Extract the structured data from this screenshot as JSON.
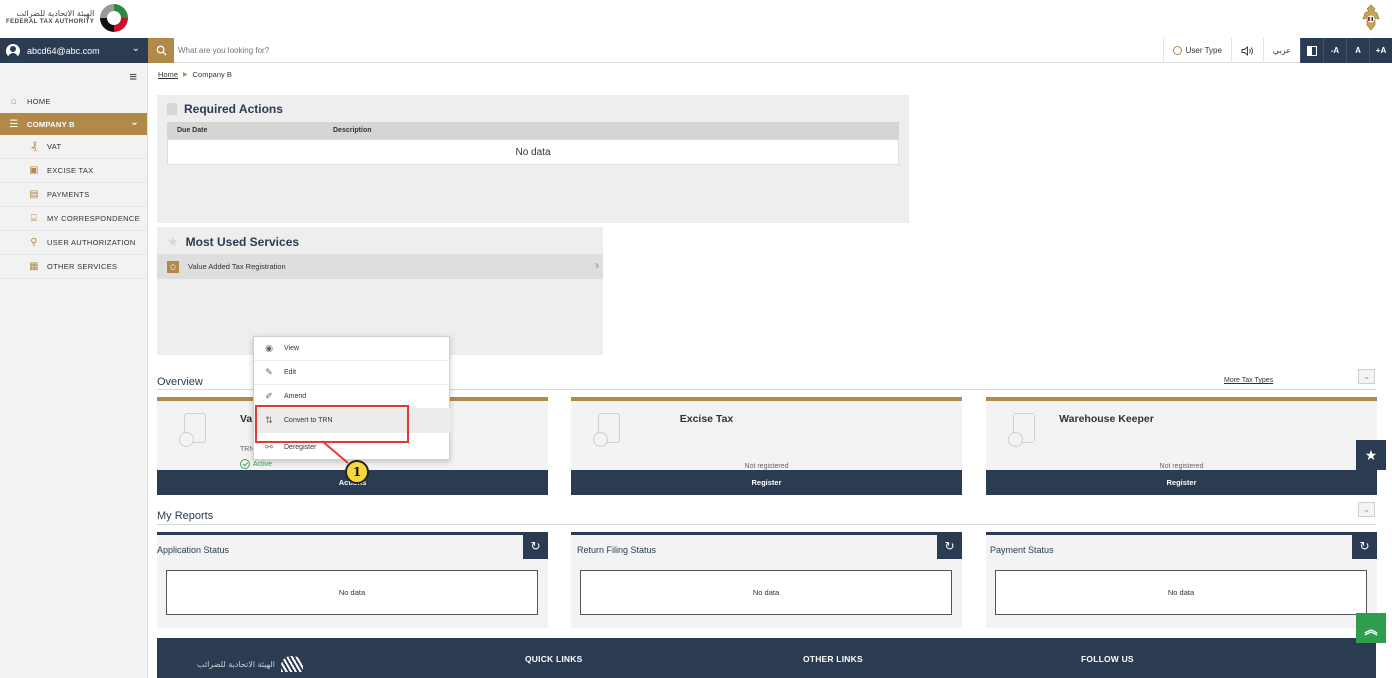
{
  "header": {
    "logo_ar": "الهيئة الاتحادية للضرائب",
    "logo_en": "FEDERAL TAX AUTHORITY"
  },
  "navbar": {
    "user_email": "abcd64@abc.com",
    "search_placeholder": "What are you looking for?",
    "user_type": "User Type",
    "language": "عربي",
    "font_decrease": "-A",
    "font_normal": "A",
    "font_increase": "+A"
  },
  "sidebar": {
    "home": "HOME",
    "company": "COMPANY B",
    "items": [
      {
        "label": "VAT",
        "icon": "vat-icon"
      },
      {
        "label": "EXCISE TAX",
        "icon": "excise-icon"
      },
      {
        "label": "PAYMENTS",
        "icon": "payments-icon"
      },
      {
        "label": "MY CORRESPONDENCE",
        "icon": "correspondence-icon"
      },
      {
        "label": "USER AUTHORIZATION",
        "icon": "user-auth-icon"
      },
      {
        "label": "OTHER SERVICES",
        "icon": "other-services-icon"
      }
    ]
  },
  "breadcrumb": {
    "home": "Home",
    "current": "Company B"
  },
  "required_actions": {
    "title": "Required Actions",
    "columns": [
      "Due Date",
      "Description"
    ],
    "empty": "No data"
  },
  "most_used": {
    "title": "Most Used Services",
    "items": [
      "Value Added Tax Registration"
    ]
  },
  "overview": {
    "title": "Overview",
    "more_link": "More Tax Types",
    "cards": [
      {
        "title": "Va",
        "trn_label": "TRN",
        "status": "Active",
        "action": "Actions"
      },
      {
        "title": "Excise Tax",
        "status": "Not registered",
        "action": "Register"
      },
      {
        "title": "Warehouse Keeper",
        "status": "Not registered",
        "action": "Register"
      }
    ]
  },
  "context_menu": {
    "items": [
      {
        "label": "View",
        "icon": "eye-icon"
      },
      {
        "label": "Edit",
        "icon": "pencil-icon"
      },
      {
        "label": "Amend",
        "icon": "amend-icon"
      },
      {
        "label": "Convert to TRN",
        "icon": "convert-icon"
      },
      {
        "label": "Deregister",
        "icon": "deregister-icon"
      }
    ]
  },
  "annotation": {
    "number": "1"
  },
  "reports": {
    "title": "My Reports",
    "cards": [
      {
        "title": "Application Status",
        "empty": "No data"
      },
      {
        "title": "Return Filing Status",
        "empty": "No data"
      },
      {
        "title": "Payment Status",
        "empty": "No data"
      }
    ]
  },
  "footer": {
    "logo_ar": "الهيئة الاتحادية للضرائب",
    "quick_links": "QUICK LINKS",
    "other_links": "OTHER LINKS",
    "follow_us": "FOLLOW US"
  },
  "colors": {
    "navy": "#2a3b52",
    "gold": "#b18a4a",
    "active_green": "#3aa655",
    "highlight_red": "#e53935",
    "badge_yellow": "#f7d73a"
  }
}
